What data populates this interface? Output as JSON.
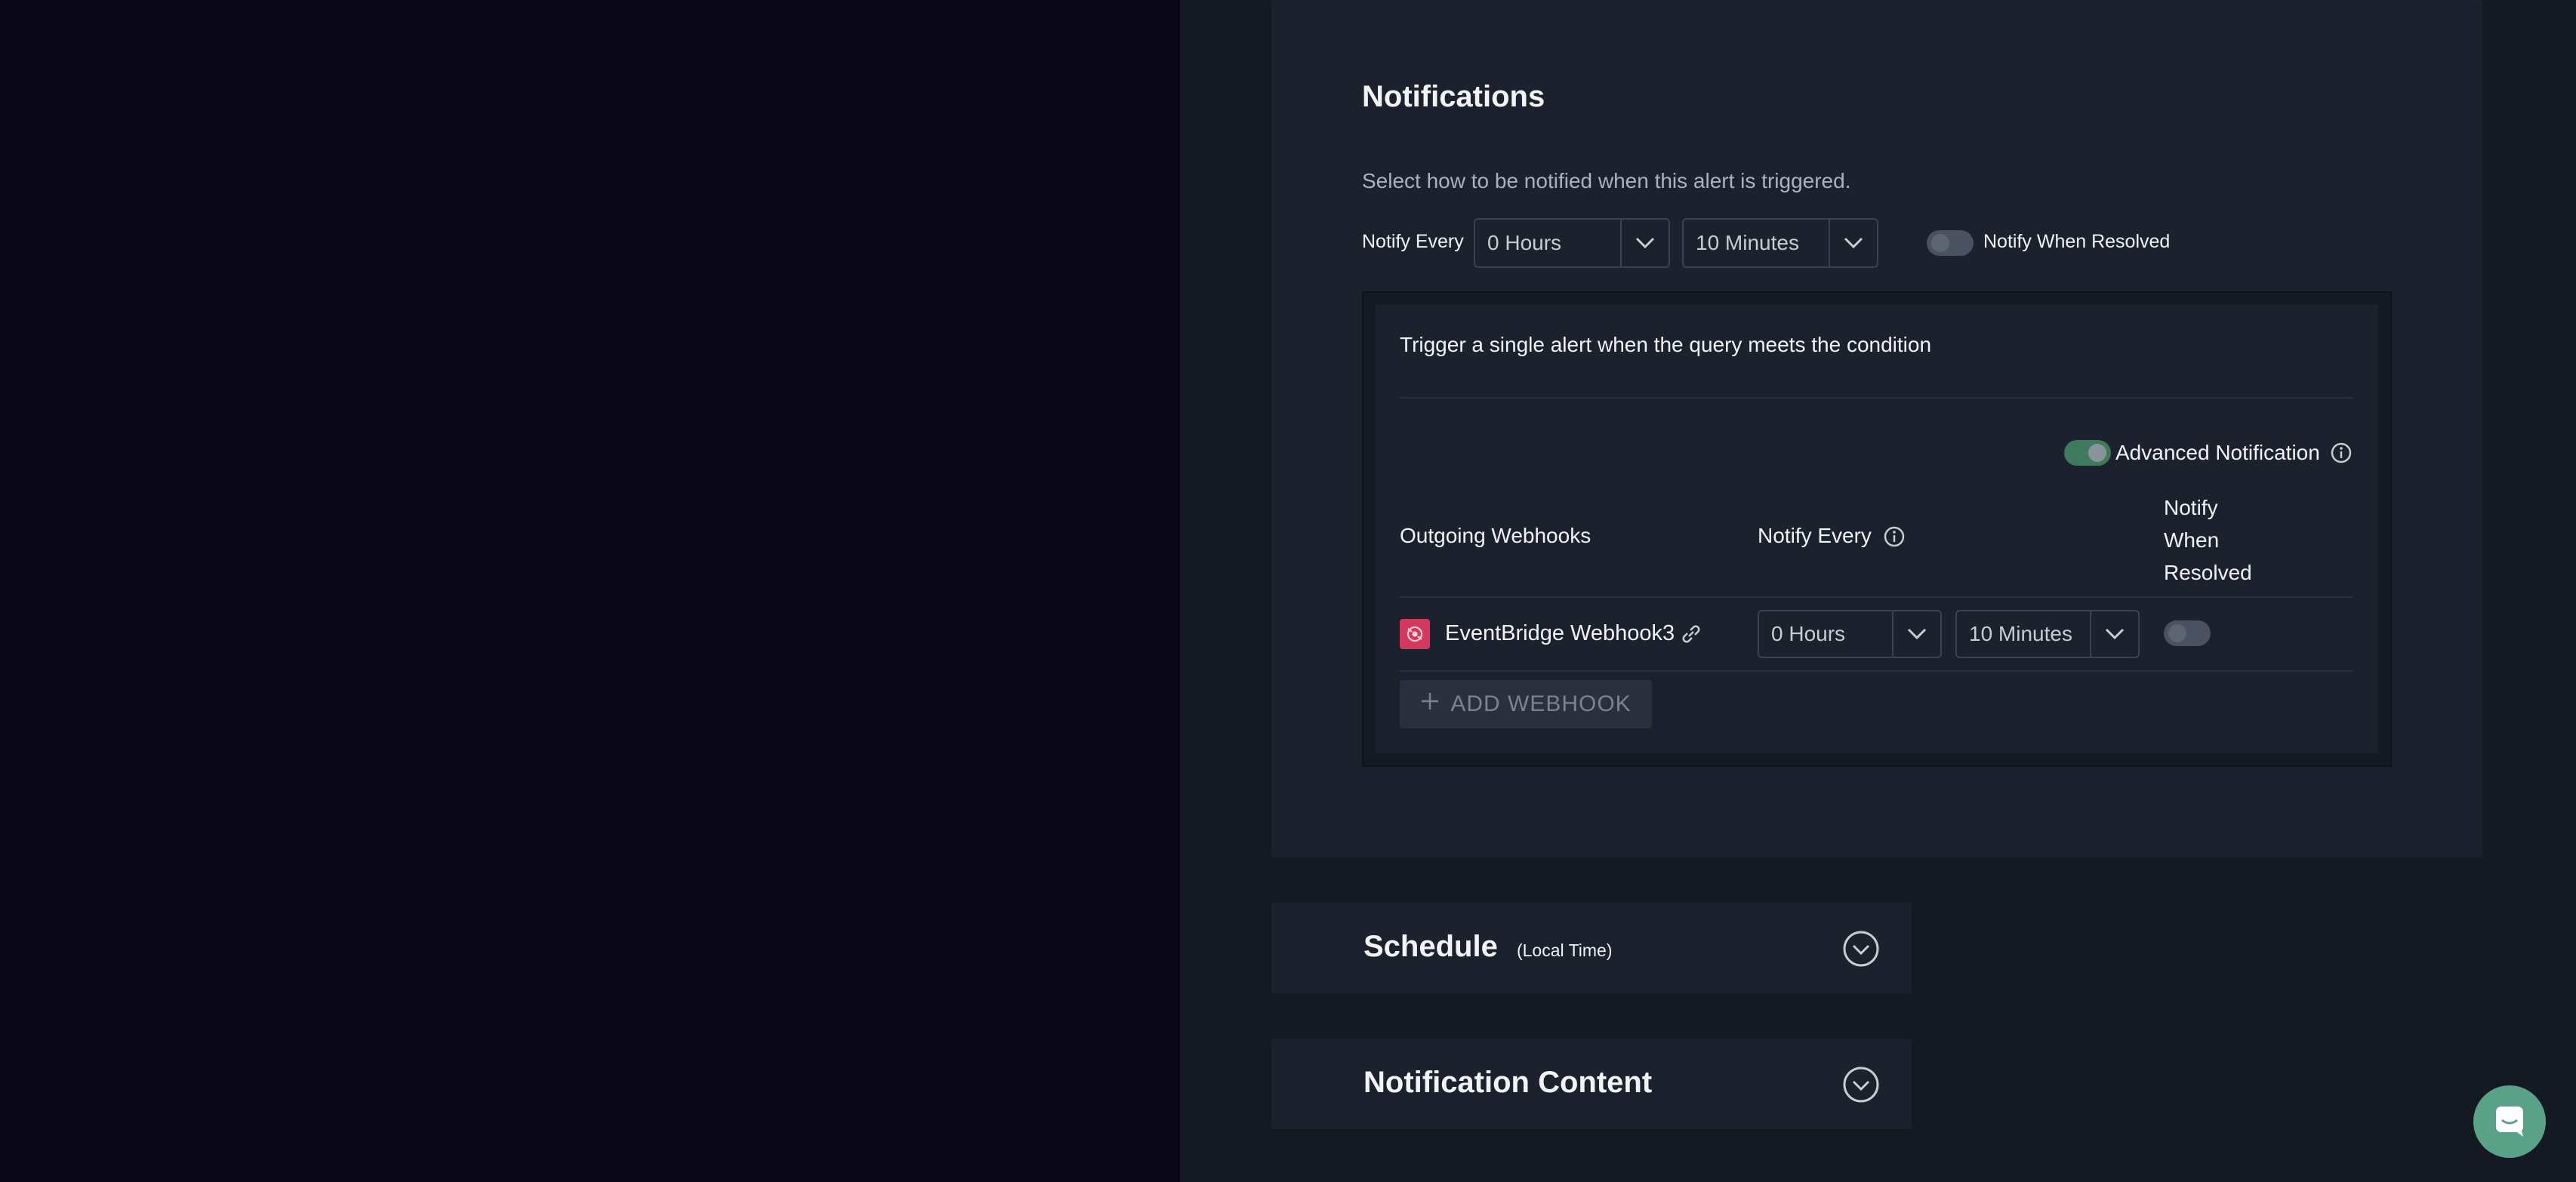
{
  "notifications": {
    "title": "Notifications",
    "description": "Select how to be notified when this alert is triggered.",
    "notify_every_label": "Notify Every",
    "hours_value": "0 Hours",
    "minutes_value": "10 Minutes",
    "notify_when_resolved_label": "Notify When Resolved",
    "notify_when_resolved_on": false
  },
  "trigger": {
    "text": "Trigger a single alert when the query meets the condition",
    "advanced_label": "Advanced Notification",
    "advanced_on": true
  },
  "webhooks_table": {
    "col_webhooks": "Outgoing Webhooks",
    "col_notify_every": "Notify Every",
    "col_resolved_line1": "Notify",
    "col_resolved_line2": "When",
    "col_resolved_line3": "Resolved",
    "rows": [
      {
        "name": "EventBridge Webhook3",
        "hours": "0 Hours",
        "minutes": "10 Minutes",
        "resolved_on": false
      }
    ],
    "add_label": "ADD WEBHOOK"
  },
  "schedule": {
    "title": "Schedule",
    "subtitle": "(Local Time)"
  },
  "notification_content": {
    "title": "Notification Content"
  },
  "colors": {
    "accent_green": "#5aa287",
    "page_bg": "#0a0818",
    "card_bg": "#1c222d"
  },
  "icons": [
    "chevron-down-icon",
    "info-icon",
    "link-icon",
    "eventbridge-icon",
    "plus-icon",
    "chevron-circle-icon",
    "chat-icon"
  ]
}
